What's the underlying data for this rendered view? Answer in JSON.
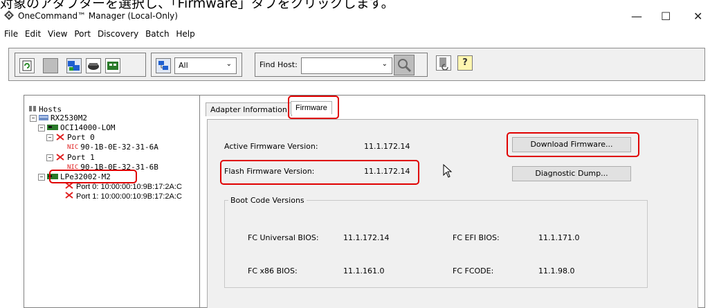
{
  "caption": "対象のアダプターを選択し、「Firmware」タブをクリックします。",
  "window": {
    "title": "OneCommand™ Manager (Local-Only)",
    "minimize": "—",
    "maximize": "☐",
    "close": "✕"
  },
  "menu": [
    "File",
    "Edit",
    "View",
    "Port",
    "Discovery",
    "Batch",
    "Help"
  ],
  "toolbar": {
    "filter_value": "All",
    "find_host_label": "Find Host:",
    "find_host_value": "",
    "help_glyph": "?"
  },
  "tree": {
    "root": "Hosts",
    "host": "RX2530M2",
    "adapter1": "OCI14000-LOM",
    "port0": "Port 0",
    "nic0": "90-1B-0E-32-31-6A",
    "port1": "Port 1",
    "nic1": "90-1B-0E-32-31-6B",
    "adapter2": "LPe32002-M2",
    "fcport0": "Port 0: 10:00:00:10:9B:17:2A:C",
    "fcport1": "Port 1: 10:00:00:10:9B:17:2A:C",
    "nic_badge": "NIC"
  },
  "tabs": {
    "adapter_info": "Adapter Information",
    "firmware": "Firmware"
  },
  "firmware": {
    "active_label": "Active Firmware Version:",
    "active_value": "11.1.172.14",
    "flash_label": "Flash Firmware Version:",
    "flash_value": "11.1.172.14",
    "download_button": "Download Firmware...",
    "diag_button": "Diagnostic Dump...",
    "boot_title": "Boot Code Versions",
    "fc_universal_label": "FC Universal BIOS:",
    "fc_universal_value": "11.1.172.14",
    "fc_efi_label": "FC EFI BIOS:",
    "fc_efi_value": "11.1.171.0",
    "fc_x86_label": "FC x86 BIOS:",
    "fc_x86_value": "11.1.161.0",
    "fc_fcode_label": "FC FCODE:",
    "fc_fcode_value": "11.1.98.0"
  },
  "colors": {
    "highlight_red": "#e00000",
    "panel_bg": "#f0f0f0",
    "toolbar_blue": "#1e5fd0"
  }
}
